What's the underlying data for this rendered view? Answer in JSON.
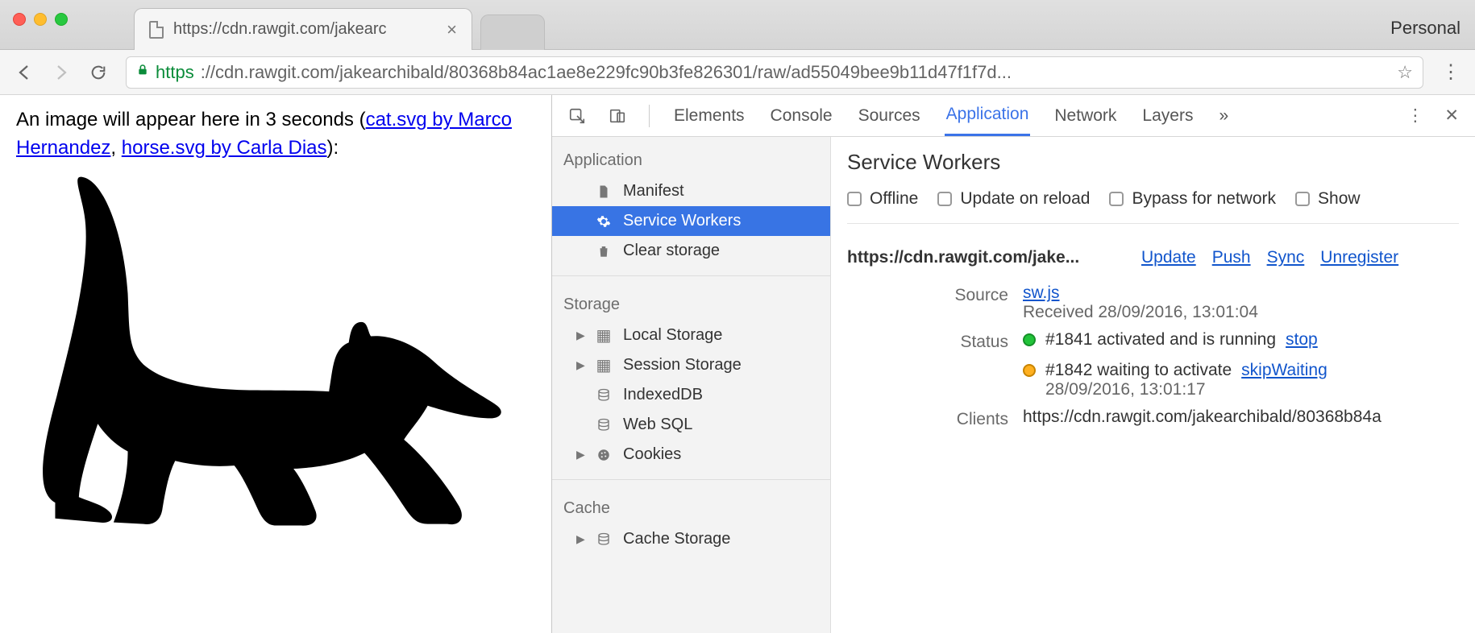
{
  "window": {
    "personal": "Personal"
  },
  "tab": {
    "title": "https://cdn.rawgit.com/jakearc"
  },
  "address": {
    "secure": "https",
    "url_display": "://cdn.rawgit.com/jakearchibald/80368b84ac1ae8e229fc90b3fe826301/raw/ad55049bee9b11d47f1f7d..."
  },
  "page": {
    "text_prefix": "An image will appear here in 3 seconds (",
    "link1": "cat.svg by Marco Hernandez",
    "sep": ", ",
    "link2": "horse.svg by Carla Dias",
    "text_suffix": "):"
  },
  "devtools": {
    "tabs": [
      "Elements",
      "Console",
      "Sources",
      "Application",
      "Network",
      "Layers"
    ],
    "active_tab": "Application",
    "more": "»"
  },
  "sidebar": {
    "sections": [
      {
        "title": "Application",
        "items": [
          {
            "label": "Manifest",
            "icon": "file"
          },
          {
            "label": "Service Workers",
            "icon": "gear",
            "selected": true
          },
          {
            "label": "Clear storage",
            "icon": "trash"
          }
        ]
      },
      {
        "title": "Storage",
        "items": [
          {
            "label": "Local Storage",
            "icon": "grid",
            "expandable": true
          },
          {
            "label": "Session Storage",
            "icon": "grid",
            "expandable": true
          },
          {
            "label": "IndexedDB",
            "icon": "db"
          },
          {
            "label": "Web SQL",
            "icon": "db"
          },
          {
            "label": "Cookies",
            "icon": "cookie",
            "expandable": true
          }
        ]
      },
      {
        "title": "Cache",
        "items": [
          {
            "label": "Cache Storage",
            "icon": "db",
            "expandable": true
          }
        ]
      }
    ]
  },
  "panel": {
    "title": "Service Workers",
    "checks": [
      "Offline",
      "Update on reload",
      "Bypass for network",
      "Show"
    ],
    "origin": "https://cdn.rawgit.com/jake...",
    "origin_links": [
      "Update",
      "Push",
      "Sync",
      "Unregister"
    ],
    "source_label": "Source",
    "source_link": "sw.js",
    "source_received": "Received 28/09/2016, 13:01:04",
    "status_label": "Status",
    "status1_text": "#1841 activated and is running",
    "status1_action": "stop",
    "status2_text": "#1842 waiting to activate",
    "status2_action": "skipWaiting",
    "status2_time": "28/09/2016, 13:01:17",
    "clients_label": "Clients",
    "clients_value": "https://cdn.rawgit.com/jakearchibald/80368b84a"
  }
}
